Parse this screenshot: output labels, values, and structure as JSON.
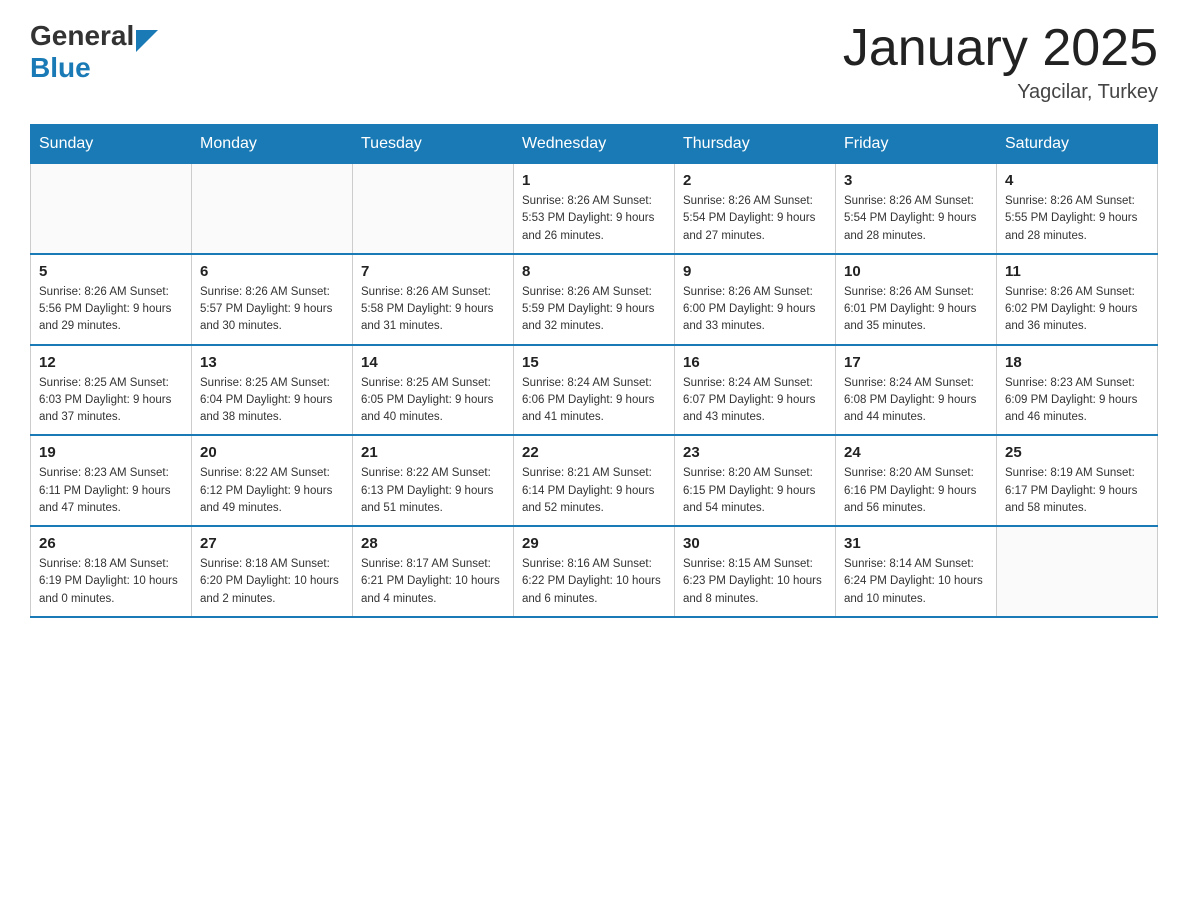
{
  "header": {
    "logo_general": "General",
    "logo_blue": "Blue",
    "month_title": "January 2025",
    "location": "Yagcilar, Turkey"
  },
  "days_of_week": [
    "Sunday",
    "Monday",
    "Tuesday",
    "Wednesday",
    "Thursday",
    "Friday",
    "Saturday"
  ],
  "weeks": [
    [
      {
        "day": "",
        "info": ""
      },
      {
        "day": "",
        "info": ""
      },
      {
        "day": "",
        "info": ""
      },
      {
        "day": "1",
        "info": "Sunrise: 8:26 AM\nSunset: 5:53 PM\nDaylight: 9 hours\nand 26 minutes."
      },
      {
        "day": "2",
        "info": "Sunrise: 8:26 AM\nSunset: 5:54 PM\nDaylight: 9 hours\nand 27 minutes."
      },
      {
        "day": "3",
        "info": "Sunrise: 8:26 AM\nSunset: 5:54 PM\nDaylight: 9 hours\nand 28 minutes."
      },
      {
        "day": "4",
        "info": "Sunrise: 8:26 AM\nSunset: 5:55 PM\nDaylight: 9 hours\nand 28 minutes."
      }
    ],
    [
      {
        "day": "5",
        "info": "Sunrise: 8:26 AM\nSunset: 5:56 PM\nDaylight: 9 hours\nand 29 minutes."
      },
      {
        "day": "6",
        "info": "Sunrise: 8:26 AM\nSunset: 5:57 PM\nDaylight: 9 hours\nand 30 minutes."
      },
      {
        "day": "7",
        "info": "Sunrise: 8:26 AM\nSunset: 5:58 PM\nDaylight: 9 hours\nand 31 minutes."
      },
      {
        "day": "8",
        "info": "Sunrise: 8:26 AM\nSunset: 5:59 PM\nDaylight: 9 hours\nand 32 minutes."
      },
      {
        "day": "9",
        "info": "Sunrise: 8:26 AM\nSunset: 6:00 PM\nDaylight: 9 hours\nand 33 minutes."
      },
      {
        "day": "10",
        "info": "Sunrise: 8:26 AM\nSunset: 6:01 PM\nDaylight: 9 hours\nand 35 minutes."
      },
      {
        "day": "11",
        "info": "Sunrise: 8:26 AM\nSunset: 6:02 PM\nDaylight: 9 hours\nand 36 minutes."
      }
    ],
    [
      {
        "day": "12",
        "info": "Sunrise: 8:25 AM\nSunset: 6:03 PM\nDaylight: 9 hours\nand 37 minutes."
      },
      {
        "day": "13",
        "info": "Sunrise: 8:25 AM\nSunset: 6:04 PM\nDaylight: 9 hours\nand 38 minutes."
      },
      {
        "day": "14",
        "info": "Sunrise: 8:25 AM\nSunset: 6:05 PM\nDaylight: 9 hours\nand 40 minutes."
      },
      {
        "day": "15",
        "info": "Sunrise: 8:24 AM\nSunset: 6:06 PM\nDaylight: 9 hours\nand 41 minutes."
      },
      {
        "day": "16",
        "info": "Sunrise: 8:24 AM\nSunset: 6:07 PM\nDaylight: 9 hours\nand 43 minutes."
      },
      {
        "day": "17",
        "info": "Sunrise: 8:24 AM\nSunset: 6:08 PM\nDaylight: 9 hours\nand 44 minutes."
      },
      {
        "day": "18",
        "info": "Sunrise: 8:23 AM\nSunset: 6:09 PM\nDaylight: 9 hours\nand 46 minutes."
      }
    ],
    [
      {
        "day": "19",
        "info": "Sunrise: 8:23 AM\nSunset: 6:11 PM\nDaylight: 9 hours\nand 47 minutes."
      },
      {
        "day": "20",
        "info": "Sunrise: 8:22 AM\nSunset: 6:12 PM\nDaylight: 9 hours\nand 49 minutes."
      },
      {
        "day": "21",
        "info": "Sunrise: 8:22 AM\nSunset: 6:13 PM\nDaylight: 9 hours\nand 51 minutes."
      },
      {
        "day": "22",
        "info": "Sunrise: 8:21 AM\nSunset: 6:14 PM\nDaylight: 9 hours\nand 52 minutes."
      },
      {
        "day": "23",
        "info": "Sunrise: 8:20 AM\nSunset: 6:15 PM\nDaylight: 9 hours\nand 54 minutes."
      },
      {
        "day": "24",
        "info": "Sunrise: 8:20 AM\nSunset: 6:16 PM\nDaylight: 9 hours\nand 56 minutes."
      },
      {
        "day": "25",
        "info": "Sunrise: 8:19 AM\nSunset: 6:17 PM\nDaylight: 9 hours\nand 58 minutes."
      }
    ],
    [
      {
        "day": "26",
        "info": "Sunrise: 8:18 AM\nSunset: 6:19 PM\nDaylight: 10 hours\nand 0 minutes."
      },
      {
        "day": "27",
        "info": "Sunrise: 8:18 AM\nSunset: 6:20 PM\nDaylight: 10 hours\nand 2 minutes."
      },
      {
        "day": "28",
        "info": "Sunrise: 8:17 AM\nSunset: 6:21 PM\nDaylight: 10 hours\nand 4 minutes."
      },
      {
        "day": "29",
        "info": "Sunrise: 8:16 AM\nSunset: 6:22 PM\nDaylight: 10 hours\nand 6 minutes."
      },
      {
        "day": "30",
        "info": "Sunrise: 8:15 AM\nSunset: 6:23 PM\nDaylight: 10 hours\nand 8 minutes."
      },
      {
        "day": "31",
        "info": "Sunrise: 8:14 AM\nSunset: 6:24 PM\nDaylight: 10 hours\nand 10 minutes."
      },
      {
        "day": "",
        "info": ""
      }
    ]
  ]
}
